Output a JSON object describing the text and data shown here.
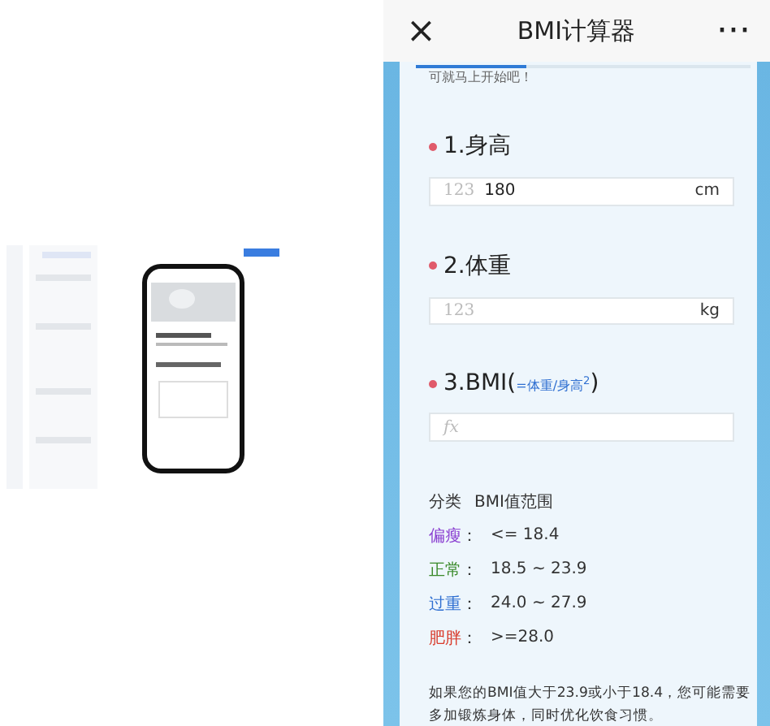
{
  "phone": {
    "nav": {
      "close": "×",
      "title": "BMI计算器",
      "more": "···"
    },
    "progress": {
      "level": 0.33
    },
    "cut_text": "可就马上开始吧！",
    "questions": [
      {
        "required": true,
        "label": "1.身高",
        "kind": "number",
        "value": "180",
        "placeholder": "123",
        "unit": "cm"
      },
      {
        "required": true,
        "label": "2.体重",
        "kind": "number",
        "placeholder": "123",
        "unit": "kg"
      },
      {
        "required": true,
        "label": "3.BMI(",
        "hint": "=体重/身高$^{2}$",
        "label_end": ")",
        "kind": "formula",
        "placeholder": "fx"
      }
    ],
    "table_header": [
      "分类",
      "BMI值范围"
    ],
    "categories": [
      {
        "name": "偏瘦",
        "sep": "：",
        "range": "<= 18.4",
        "color": "#8a3fd1"
      },
      {
        "name": "正常",
        "sep": "：",
        "range": "18.5 ~ 23.9",
        "color": "#3a8a2a"
      },
      {
        "name": "过重",
        "sep": "：",
        "range": "24.0 ~ 27.9",
        "color": "#2f6fd1"
      },
      {
        "name": "肥胖",
        "sep": "：",
        "range": ">=28.0",
        "color": "#d93a2a"
      }
    ],
    "advice": [
      "如果您的BMI值大于23.9或小于18.4，您可能需要",
      "多加锻炼身体，同时优化饮食习惯。"
    ]
  }
}
